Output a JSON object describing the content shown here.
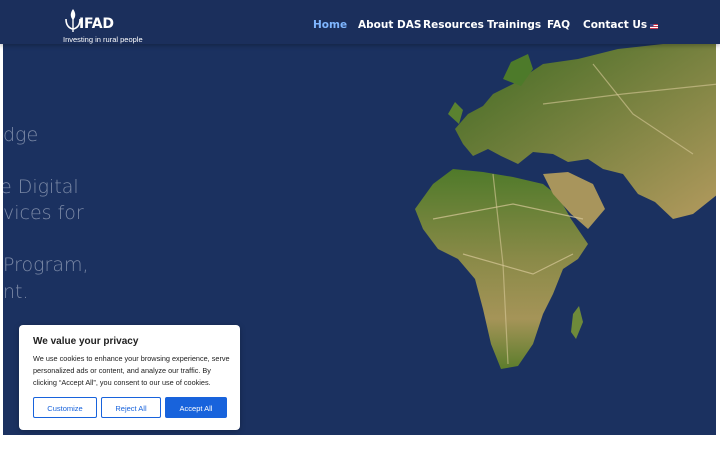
{
  "header": {
    "logo_text": "IFAD",
    "logo_tagline": "Investing in rural people",
    "nav": [
      {
        "label": "Home",
        "active": true
      },
      {
        "label": "About DAS"
      },
      {
        "label": "Resources"
      },
      {
        "label": "Trainings"
      },
      {
        "label": "FAQ"
      },
      {
        "label": "Contact Us"
      }
    ],
    "language_flag": "us-flag-icon"
  },
  "hero": {
    "lines": [
      "dge",
      "e Digital",
      "vices for",
      "Program,",
      "nt."
    ],
    "image": "world-map-africa-europe"
  },
  "cookie_banner": {
    "title": "We value your privacy",
    "text": "We use cookies to enhance your browsing experience, serve personalized ads or content, and analyze our traffic. By clicking “Accept All”, you consent to our use of cookies.",
    "customize_label": "Customize",
    "reject_label": "Reject All",
    "accept_label": "Accept All"
  },
  "colors": {
    "header_bg": "#1b2f5c",
    "hero_bg": "#1b3160",
    "active_nav": "#7fb6ff",
    "cookie_accent": "#1863dc"
  }
}
